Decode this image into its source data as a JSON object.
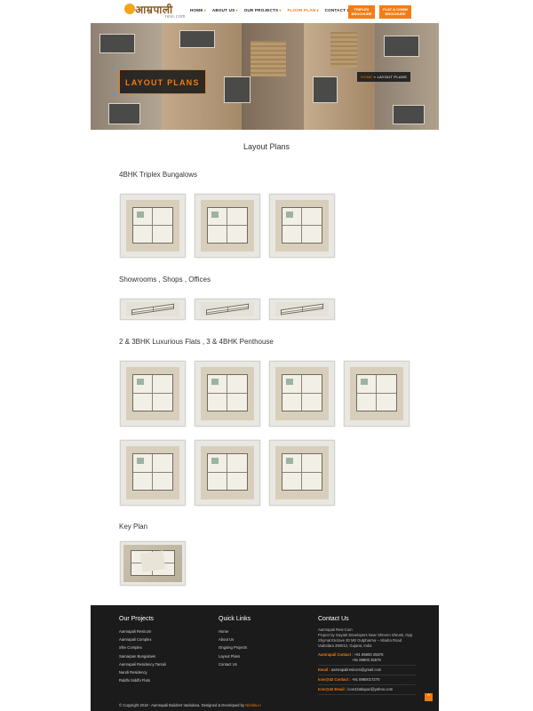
{
  "header": {
    "logo_text": "आम्रपाली",
    "logo_sub": "resi.com",
    "nav": [
      {
        "label": "HOME",
        "caret": true,
        "active": false
      },
      {
        "label": "ABOUT US",
        "caret": true,
        "active": false
      },
      {
        "label": "OUR PROJECTS",
        "caret": true,
        "active": false
      },
      {
        "label": "FLOOR PLAN",
        "caret": true,
        "active": true
      },
      {
        "label": "CONTACT US",
        "caret": false,
        "active": false
      }
    ],
    "btn_brochure": "TRIPLEX BROCHURE",
    "btn_flat": "FLAT & COMM BROCHURE"
  },
  "hero": {
    "title": "LAYOUT PLANS",
    "crumb_home": "HOME",
    "crumb_sep": " » ",
    "crumb_current": "LAYOUT PLANS"
  },
  "page_heading": "Layout Plans",
  "sections": {
    "triplex": "4BHK Triplex Bungalows",
    "showrooms": "Showrooms , Shops , Offices",
    "flats": "2 & 3BHK Luxurious Flats , 3 & 4BHK Penthouse",
    "key": "Key Plan"
  },
  "footer": {
    "projects_title": "Our Projects",
    "projects": [
      "Aamrapali Resicom",
      "Aamrapali Complex",
      "Shiv Complex",
      "Samarpan Bungalows",
      "Aamrapali Residency Tarsali",
      "Nandi Residency",
      "Riddhi Siddhi Flats"
    ],
    "links_title": "Quick Links",
    "links": [
      "Home",
      "About Us",
      "Ongoing Projects",
      "Layout Plans",
      "Contact Us"
    ],
    "contact_title": "Contact Us",
    "company": "Aamrapali Resi-Com",
    "address": "Project by Gayatri Developers Near Shreem Shrusti, Opp. Shymal Enclave 30 Mtr Gutpharma – Atladra Road Vadodara 390012, Gujarat, India",
    "contact_label": "Aamrapali Contact :",
    "contact_phone1": "+91 89800 25578",
    "contact_phone2": "+91 89800 25579",
    "email_label": "Email :",
    "email": "aamrapaliresicom@gmail.com",
    "icon_contact_label": "Icon@42 Contact :",
    "icon_contact": "+91 8980017270",
    "icon_email_label": "Icon@42 Email :",
    "icon_email": "icon42atlapuri@yahoo.com",
    "copyright": "© Copyright 2018 - Aamrapali Builders Vadodara. Designed & Developed by",
    "developer": "Nimbla.in",
    "to_top": "^"
  }
}
